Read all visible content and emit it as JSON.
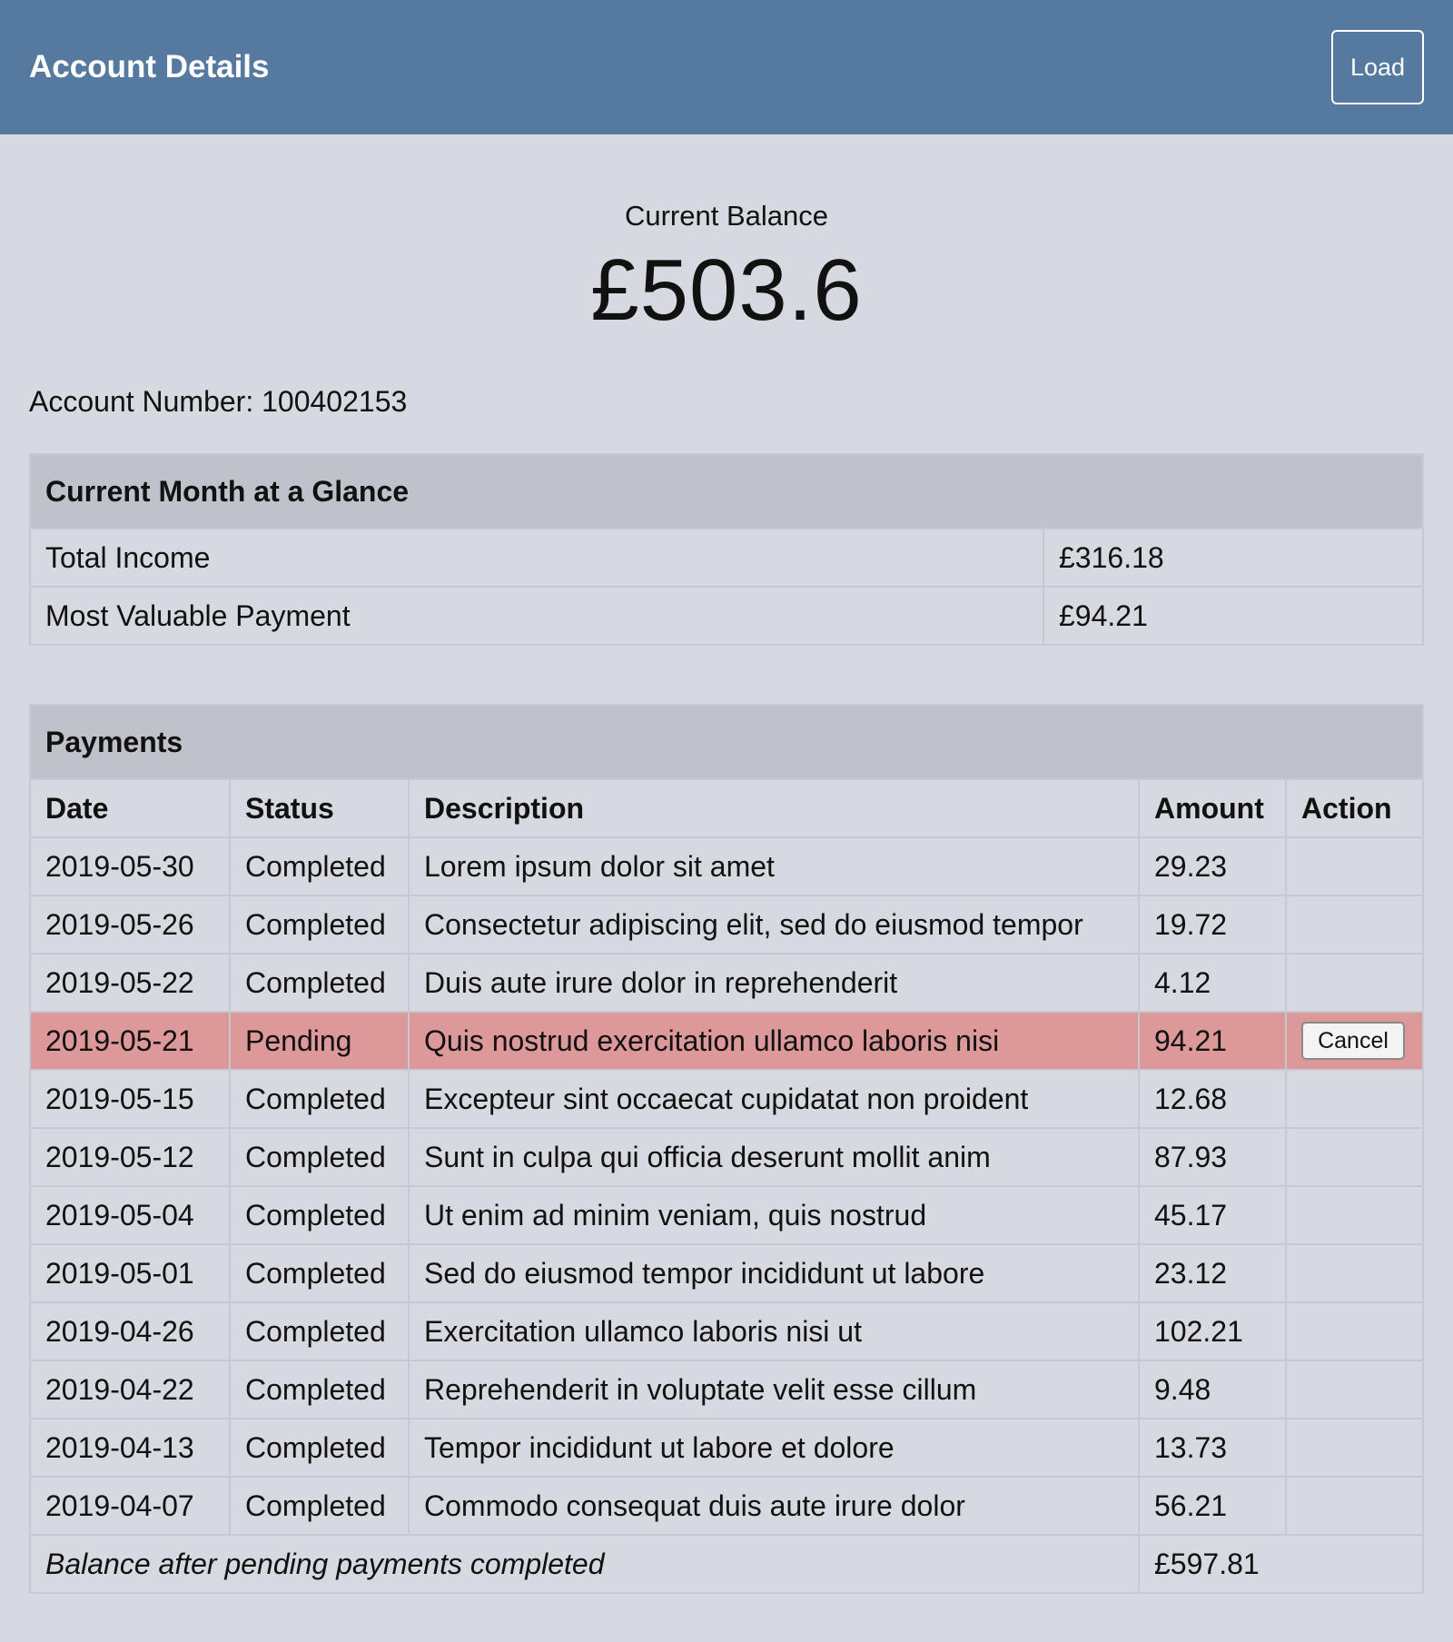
{
  "header": {
    "title": "Account Details",
    "load_label": "Load"
  },
  "balance": {
    "label": "Current Balance",
    "value": "£503.6"
  },
  "account": {
    "label": "Account Number:",
    "number": "100402153"
  },
  "glance": {
    "title": "Current Month at a Glance",
    "rows": [
      {
        "label": "Total Income",
        "value": "£316.18"
      },
      {
        "label": "Most Valuable Payment",
        "value": "£94.21"
      }
    ]
  },
  "payments": {
    "title": "Payments",
    "columns": {
      "date": "Date",
      "status": "Status",
      "description": "Description",
      "amount": "Amount",
      "action": "Action"
    },
    "rows": [
      {
        "date": "2019-05-30",
        "status": "Completed",
        "description": "Lorem ipsum dolor sit amet",
        "amount": "29.23",
        "action": ""
      },
      {
        "date": "2019-05-26",
        "status": "Completed",
        "description": "Consectetur adipiscing elit, sed do eiusmod tempor",
        "amount": "19.72",
        "action": ""
      },
      {
        "date": "2019-05-22",
        "status": "Completed",
        "description": "Duis aute irure dolor in reprehenderit",
        "amount": "4.12",
        "action": ""
      },
      {
        "date": "2019-05-21",
        "status": "Pending",
        "description": "Quis nostrud exercitation ullamco laboris nisi",
        "amount": "94.21",
        "action": "Cancel"
      },
      {
        "date": "2019-05-15",
        "status": "Completed",
        "description": "Excepteur sint occaecat cupidatat non proident",
        "amount": "12.68",
        "action": ""
      },
      {
        "date": "2019-05-12",
        "status": "Completed",
        "description": "Sunt in culpa qui officia deserunt mollit anim",
        "amount": "87.93",
        "action": ""
      },
      {
        "date": "2019-05-04",
        "status": "Completed",
        "description": "Ut enim ad minim veniam, quis nostrud",
        "amount": "45.17",
        "action": ""
      },
      {
        "date": "2019-05-01",
        "status": "Completed",
        "description": "Sed do eiusmod tempor incididunt ut labore",
        "amount": "23.12",
        "action": ""
      },
      {
        "date": "2019-04-26",
        "status": "Completed",
        "description": "Exercitation ullamco laboris nisi ut",
        "amount": "102.21",
        "action": ""
      },
      {
        "date": "2019-04-22",
        "status": "Completed",
        "description": "Reprehenderit in voluptate velit esse cillum",
        "amount": "9.48",
        "action": ""
      },
      {
        "date": "2019-04-13",
        "status": "Completed",
        "description": "Tempor incididunt ut labore et dolore",
        "amount": "13.73",
        "action": ""
      },
      {
        "date": "2019-04-07",
        "status": "Completed",
        "description": "Commodo consequat duis aute irure dolor",
        "amount": "56.21",
        "action": ""
      }
    ],
    "footer": {
      "label": "Balance after pending payments completed",
      "value": "£597.81"
    }
  },
  "colors": {
    "header_bg": "#567a9f",
    "page_bg": "#d6d9e0",
    "section_head_bg": "#bfc2cb",
    "pending_row_bg": "#dd9999"
  }
}
